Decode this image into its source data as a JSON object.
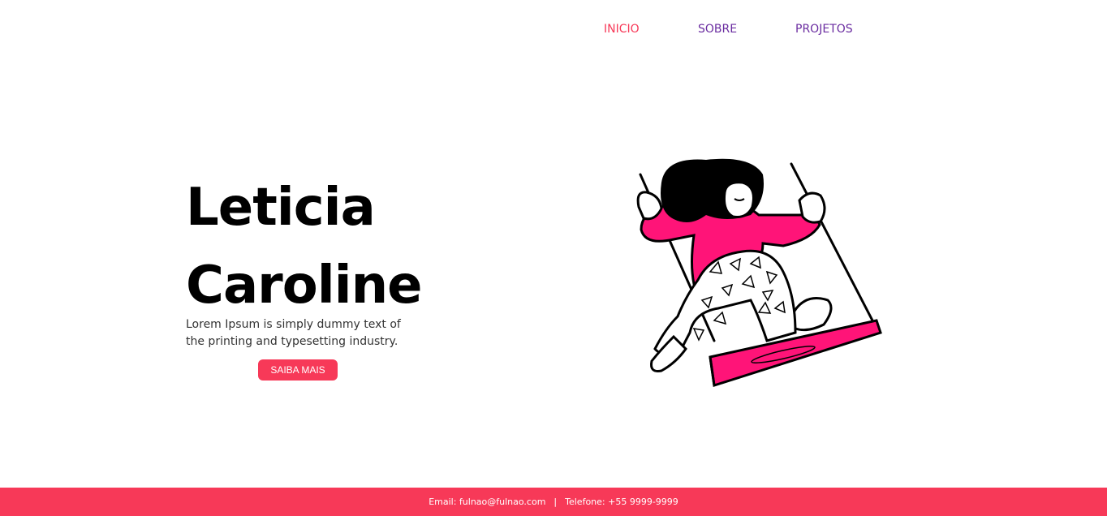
{
  "nav": {
    "items": [
      {
        "label": "INICIO",
        "active": true
      },
      {
        "label": "SOBRE",
        "active": false
      },
      {
        "label": "PROJETOS",
        "active": false
      }
    ]
  },
  "hero": {
    "title_line1": "Leticia",
    "title_line2": "Caroline",
    "description": "Lorem Ipsum is simply dummy text of the printing and typesetting industry.",
    "cta_label": "SAIBA MAIS"
  },
  "illustration": {
    "name": "girl-on-swing-illustration"
  },
  "footer": {
    "email": "Email: fulnao@fulnao.com",
    "separator": "|",
    "phone": "Telefone: +55 9999-9999"
  },
  "colors": {
    "accent": "#f73958",
    "nav_link": "#6a2ca0",
    "illustration_pink": "#ff1478"
  }
}
